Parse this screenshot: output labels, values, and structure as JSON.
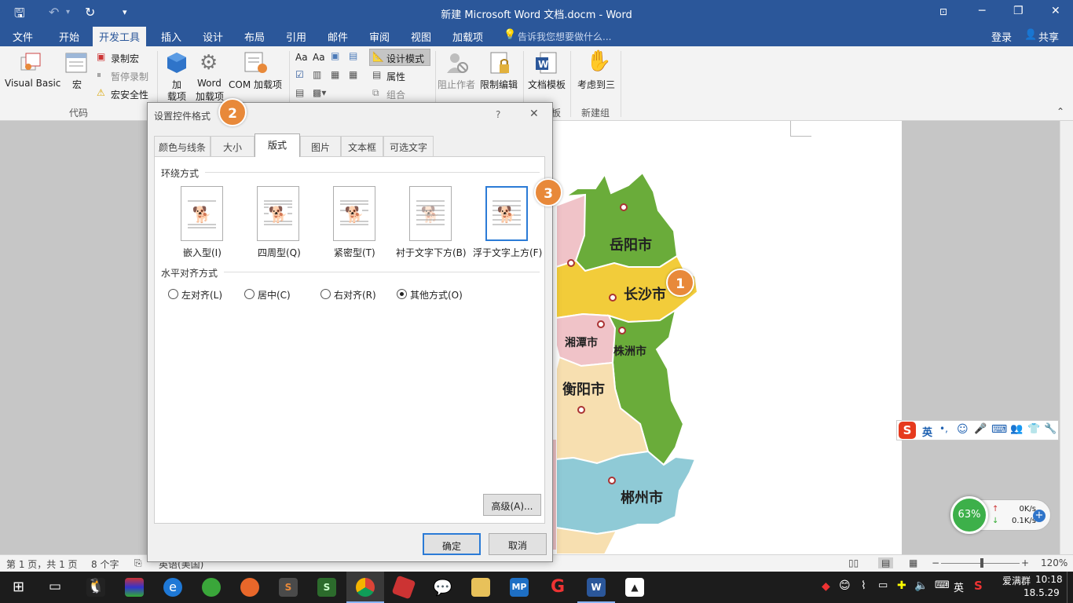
{
  "title_bar": {
    "title": "新建 Microsoft Word 文档.docm - Word"
  },
  "ribbon_tabs": [
    "文件",
    "开始",
    "开发工具",
    "插入",
    "设计",
    "布局",
    "引用",
    "邮件",
    "审阅",
    "视图",
    "加载项"
  ],
  "tell_me": "告诉我您想要做什么...",
  "account": {
    "login": "登录",
    "share": "共享"
  },
  "ribbon": {
    "code_group": {
      "label": "代码",
      "visual_basic": "Visual Basic",
      "macro": "宏",
      "record_macro": "录制宏",
      "pause_recording": "暂停录制",
      "macro_security": "宏安全性"
    },
    "addins_group": {
      "addins_line1": "加",
      "addins_line2": "载项",
      "word_addins_line1": "Word",
      "word_addins_line2": "加载项",
      "com_addins": "COM 加载项"
    },
    "controls_group": {
      "design_mode": "设计模式",
      "properties": "属性",
      "group": "组合"
    },
    "protect_group": {
      "block_authors": "阻止作者",
      "restrict_editing": "限制编辑"
    },
    "templates_group": {
      "document_template": "文档模板",
      "label_fragment": "板"
    },
    "new_group": {
      "button": "考虑到三",
      "label": "新建组"
    }
  },
  "dialog": {
    "title": "设置控件格式",
    "help": "?",
    "close": "✕",
    "tabs": [
      "颜色与线条",
      "大小",
      "版式",
      "图片",
      "文本框",
      "可选文字"
    ],
    "active_tab": "版式",
    "wrap_section": "环绕方式",
    "wrap_options": [
      "嵌入型(I)",
      "四周型(Q)",
      "紧密型(T)",
      "衬于文字下方(B)",
      "浮于文字上方(F)"
    ],
    "selected_wrap": "浮于文字上方(F)",
    "align_section": "水平对齐方式",
    "align_options": [
      "左对齐(L)",
      "居中(C)",
      "右对齐(R)",
      "其他方式(O)"
    ],
    "selected_align": "其他方式(O)",
    "advanced_button": "高级(A)...",
    "ok_button": "确定",
    "cancel_button": "取消"
  },
  "annotations": [
    "1",
    "2",
    "3"
  ],
  "map_labels": [
    "岳阳市",
    "长沙市",
    "湘潭市",
    "株洲市",
    "衡阳市",
    "郴州市"
  ],
  "status_bar": {
    "page": "第 1 页，共 1 页",
    "words": "8 个字",
    "language": "英语(美国)",
    "zoom": "120%"
  },
  "ime_toolbar": {
    "mode": "英"
  },
  "net_widget": {
    "percent": "63%",
    "up": "0K/s",
    "down": "0.1K/s"
  },
  "taskbar": {
    "ime": "英",
    "user": "爱满群",
    "time": "10:18",
    "date": "18.5.29"
  },
  "colors": {
    "word_blue": "#2b579a",
    "badge_orange": "#e8893a",
    "map_green": "#6aac3a",
    "map_yellow": "#f2cc3a",
    "map_pink": "#f0c3c8",
    "map_cream": "#f7dfb0",
    "map_blue": "#8fcad6"
  }
}
